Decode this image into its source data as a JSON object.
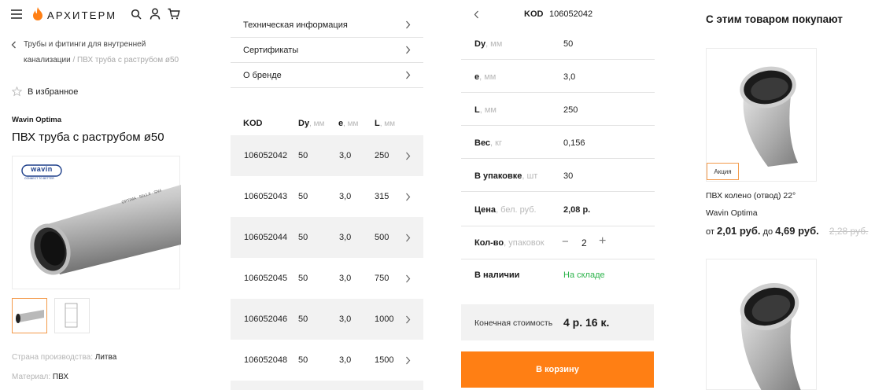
{
  "header": {
    "logo_text": "АРХИТЕРМ",
    "icons": [
      "menu-icon",
      "flame-logo-icon",
      "search-icon",
      "user-icon",
      "cart-icon"
    ]
  },
  "breadcrumb": {
    "line1": "Трубы и фитинги для внутренней",
    "line2_link": "канализации",
    "line2_rest": " / ПВХ труба с раструбом ø50"
  },
  "favorites_label": "В избранное",
  "product": {
    "brand": "Wavin Optima",
    "title": "ПВХ труба с раструбом ø50",
    "image_brand": "wavin",
    "image_tagline": "CONNECT TO BETTER",
    "image_print": "OPTIMA · 50x1.8 · SN4",
    "specs": [
      {
        "key": "Страна производства: ",
        "value": "Литва"
      },
      {
        "key": "Материал: ",
        "value": "ПВХ"
      }
    ]
  },
  "accordion": [
    {
      "label": "Техническая информация"
    },
    {
      "label": "Сертификаты"
    },
    {
      "label": "О бренде"
    }
  ],
  "table": {
    "headers": [
      {
        "label": "KOD",
        "unit": ""
      },
      {
        "label": "Dy",
        "unit": ", мм"
      },
      {
        "label": "e",
        "unit": ", мм"
      },
      {
        "label": "L",
        "unit": ", мм"
      }
    ],
    "rows": [
      {
        "kod": "106052042",
        "dy": "50",
        "e": "3,0",
        "l": "250"
      },
      {
        "kod": "106052043",
        "dy": "50",
        "e": "3,0",
        "l": "315"
      },
      {
        "kod": "106052044",
        "dy": "50",
        "e": "3,0",
        "l": "500"
      },
      {
        "kod": "106052045",
        "dy": "50",
        "e": "3,0",
        "l": "750"
      },
      {
        "kod": "106052046",
        "dy": "50",
        "e": "3,0",
        "l": "1000"
      },
      {
        "kod": "106052048",
        "dy": "50",
        "e": "3,0",
        "l": "1500"
      }
    ]
  },
  "details": {
    "kod_label": "KOD",
    "kod_value": "106052042",
    "rows": [
      {
        "key": "Dy",
        "unit": ", мм",
        "value": "50"
      },
      {
        "key": "e",
        "unit": ", мм",
        "value": "3,0"
      },
      {
        "key": "L",
        "unit": ", мм",
        "value": "250"
      },
      {
        "key": "Вес",
        "unit": ", кг",
        "value": "0,156"
      },
      {
        "key": "В упаковке",
        "unit": ", шт",
        "value": "30"
      },
      {
        "key": "Цена",
        "unit": ", бел. руб.",
        "value": "2,08 р."
      }
    ],
    "qty_key": "Кол-во",
    "qty_unit": ", упаковок",
    "qty_minus": "−",
    "qty_value": "2",
    "qty_plus": "+",
    "stock_key": "В наличии",
    "stock_value": "На складе",
    "total_label": "Конечная стоимость",
    "total_value": "4 р. 16 к.",
    "cart_button": "В корзину"
  },
  "related": {
    "title": "С этим товаром покупают",
    "items": [
      {
        "badge": "Акция",
        "name": "ПВХ колено (отвод) 22°",
        "brand": "Wavin Optima",
        "from_label": "от",
        "from_price": "2,01 руб.",
        "to_label": "до",
        "to_price": "4,69 руб.",
        "old_price": "2,28 руб."
      }
    ]
  },
  "colors": {
    "accent": "#ff7f14",
    "in_stock": "#2bb34a",
    "muted": "#b5b5b5",
    "row_shade": "#f2f2f2"
  }
}
